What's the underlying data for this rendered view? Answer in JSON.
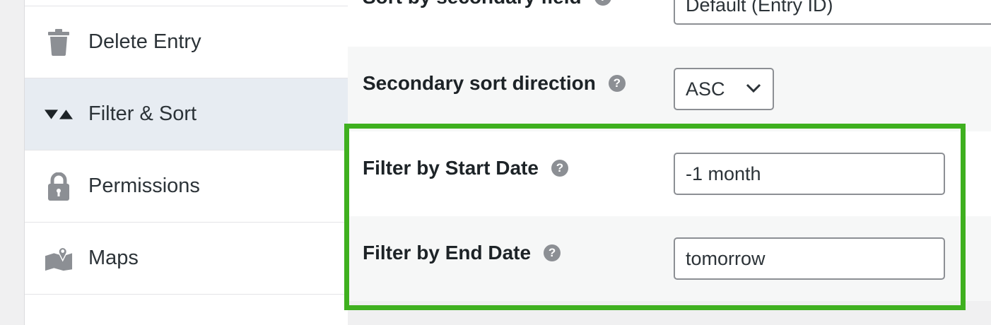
{
  "sidebar": {
    "items": [
      {
        "label": "Delete Entry",
        "icon": "trash-icon",
        "active": false
      },
      {
        "label": "Filter & Sort",
        "icon": "filter-sort-icon",
        "active": true
      },
      {
        "label": "Permissions",
        "icon": "lock-icon",
        "active": false
      },
      {
        "label": "Maps",
        "icon": "map-icon",
        "active": false
      }
    ]
  },
  "settings": {
    "secondary_field": {
      "label": "Sort by secondary field",
      "value": "Default (Entry ID)"
    },
    "secondary_direction": {
      "label": "Secondary sort direction",
      "value": "ASC"
    },
    "start_date": {
      "label": "Filter by Start Date",
      "value": "-1 month"
    },
    "end_date": {
      "label": "Filter by End Date",
      "value": "tomorrow"
    },
    "help_glyph": "?"
  },
  "colors": {
    "highlight": "#3fb01f",
    "active_item_bg": "#e7ecf2",
    "help_icon": "#8c8f94"
  }
}
